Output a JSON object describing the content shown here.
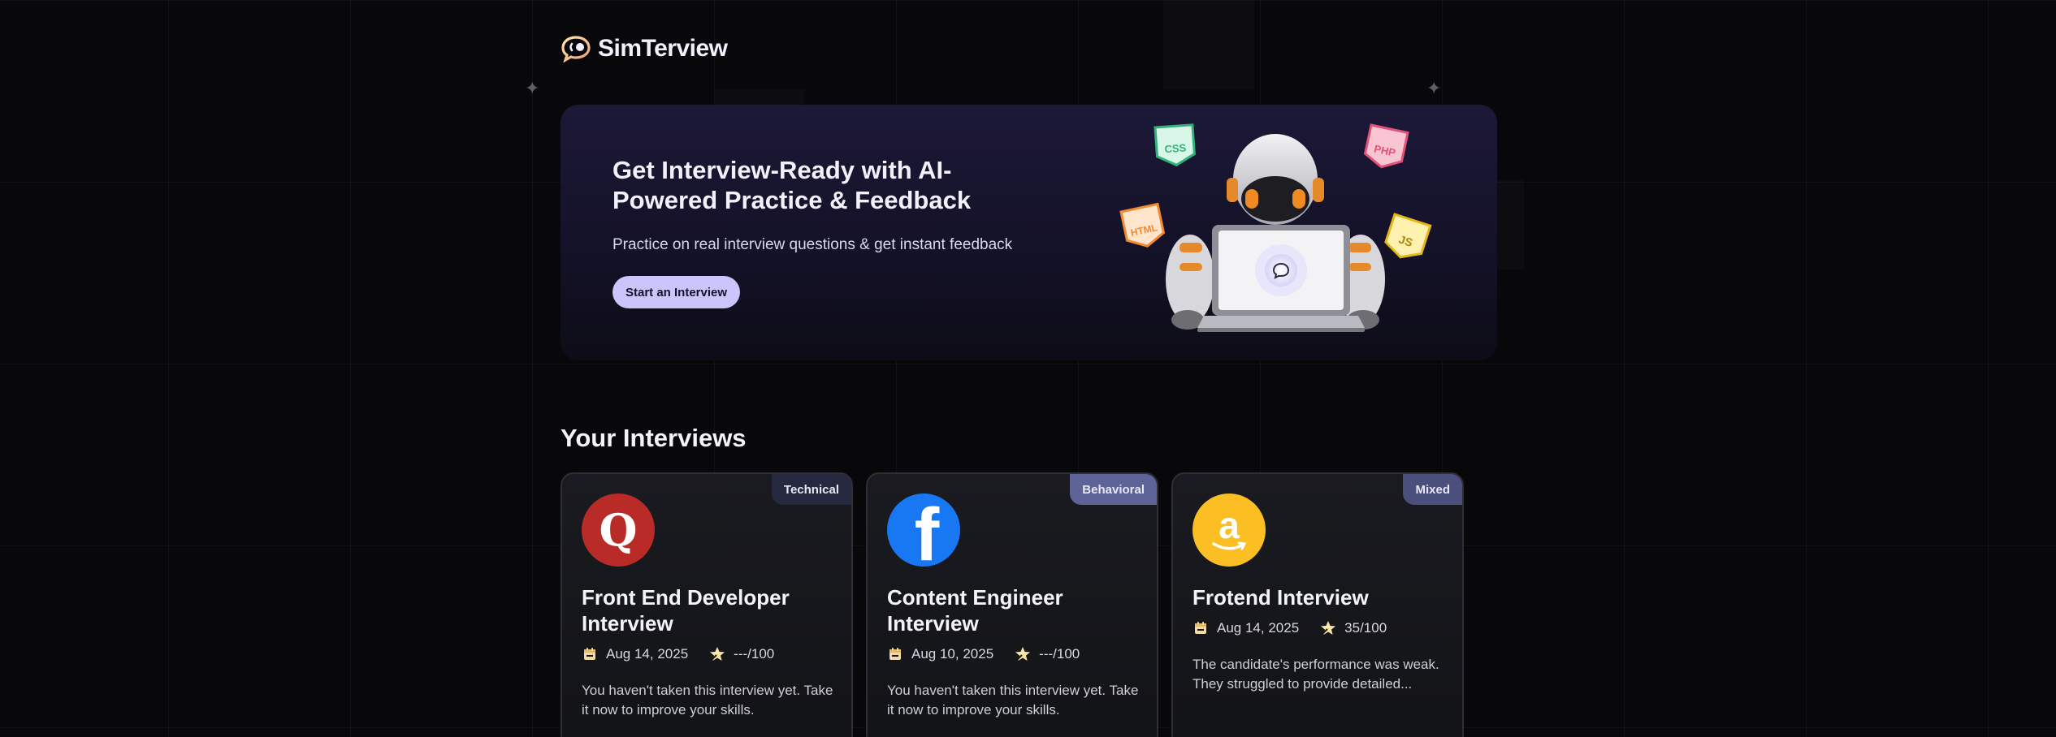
{
  "brand": {
    "name": "SimTerview",
    "accent": "#cac5fb",
    "logo_icon": "chat-bubble-icon"
  },
  "hero": {
    "title": "Get Interview-Ready with AI-Powered Practice & Feedback",
    "subtitle": "Practice on real interview questions & get instant feedback",
    "cta_label": "Start an Interview",
    "illustration": {
      "badges": [
        "CSS",
        "PHP",
        "HTML",
        "JS"
      ]
    }
  },
  "section": {
    "title": "Your Interviews"
  },
  "interviews": [
    {
      "title": "Front End Developer Interview",
      "type": "Technical",
      "company_logo": "quora-logo",
      "logo_letter": "Q",
      "logo_color": "#b92b27",
      "date": "Aug 14, 2025",
      "score": "---/100",
      "description": "You haven't taken this interview yet. Take it now to improve your skills."
    },
    {
      "title": "Content Engineer Interview",
      "type": "Behavioral",
      "company_logo": "facebook-logo",
      "logo_letter": "f",
      "logo_color": "#1877f2",
      "date": "Aug 10, 2025",
      "score": "---/100",
      "description": "You haven't taken this interview yet. Take it now to improve your skills."
    },
    {
      "title": "Frotend Interview",
      "type": "Mixed",
      "company_logo": "amazon-logo",
      "logo_letter": "a",
      "logo_color": "#fbbf24",
      "date": "Aug 14, 2025",
      "score": "35/100",
      "description": "The candidate's performance was weak. They struggled to provide detailed..."
    }
  ]
}
